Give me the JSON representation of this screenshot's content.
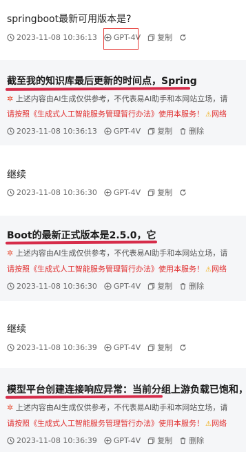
{
  "messages": [
    {
      "role": "user",
      "text": "springboot最新可用版本是?",
      "time": "2023-11-08 10:36:13",
      "model": "GPT-4V",
      "copy": "复制"
    },
    {
      "role": "ai",
      "text": "截至我的知识库最后更新的时间点，Spring",
      "disclaimer": "上述内容由AI生成仅供参考，不代表易AI助手和本网站立场，请",
      "notice": "请按照《生成式人工智能服务管理暂行办法》使用本服务！",
      "notice_tail": "网络",
      "time": "2023-11-08 10:36:13",
      "model": "GPT-4V",
      "copy": "复制",
      "delete": "删除"
    },
    {
      "role": "user",
      "text": "继续",
      "time": "2023-11-08 10:36:30",
      "model": "GPT-4V",
      "copy": "复制"
    },
    {
      "role": "ai",
      "text": "Boot的最新正式版本是2.5.0，它",
      "disclaimer": "上述内容由AI生成仅供参考，不代表易AI助手和本网站立场，请",
      "notice": "请按照《生成式人工智能服务管理暂行办法》使用本服务！",
      "notice_tail": "网络",
      "time": "2023-11-08 10:36:30",
      "model": "GPT-4V",
      "copy": "复制",
      "delete": "删除"
    },
    {
      "role": "user",
      "text": "继续",
      "time": "2023-11-08 10:36:39",
      "model": "GPT-4V",
      "copy": "复制"
    },
    {
      "role": "ai",
      "text": "模型平台创建连接响应异常：当前分组上游负载已饱和，",
      "disclaimer": "上述内容由AI生成仅供参考，不代表易AI助手和本网站立场，请",
      "notice": "请按照《生成式人工智能服务管理暂行办法》使用本服务！",
      "notice_tail": "网络",
      "time": "2023-11-08 10:36:39",
      "model": "GPT-4V",
      "copy": "复制",
      "delete": "删除"
    }
  ],
  "colors": {
    "underline": "#d62c4a",
    "notice": "#e02b2b",
    "ai_bg": "#f5f6f8",
    "highlight_box": "#e53935"
  }
}
